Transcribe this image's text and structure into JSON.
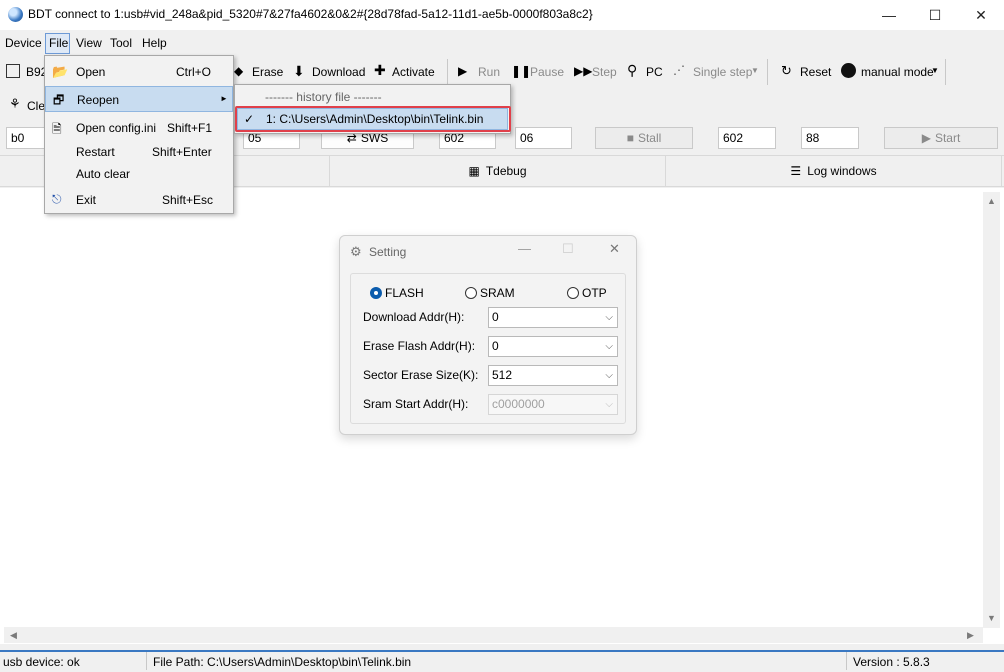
{
  "window": {
    "title": "BDT connect to 1:usb#vid_248a&pid_5320#7&27fa4602&0&2#{28d78fad-5a12-11d1-ae5b-0000f803a8c2}",
    "controls": {
      "minimize": "—",
      "maximize": "☐",
      "close": "✕"
    }
  },
  "menubar": {
    "device": "Device",
    "file": "File",
    "view": "View",
    "tool": "Tool",
    "help": "Help"
  },
  "toolbar1": {
    "chip_label": "B92",
    "erase": "Erase",
    "download": "Download",
    "activate": "Activate",
    "run": "Run",
    "pause": "Pause",
    "step": "Step",
    "pc": "PC",
    "single_step": "Single step",
    "reset": "Reset",
    "manual_mode": "manual mode"
  },
  "toolbar2": {
    "clear_label": "Cle"
  },
  "input_row": {
    "field1": "b0",
    "field2": "05",
    "sws": "SWS",
    "field3": "602",
    "field4": "06",
    "stall": "Stall",
    "field5": "602",
    "field6": "88",
    "start": "Start"
  },
  "tabs": {
    "tdebug": "Tdebug",
    "log_windows": "Log windows"
  },
  "file_menu": {
    "items": [
      {
        "label": "Open",
        "shortcut": "Ctrl+O"
      },
      {
        "label": "Reopen",
        "shortcut": ""
      },
      {
        "label": "Open config.ini",
        "shortcut": "Shift+F1"
      },
      {
        "label": "Restart",
        "shortcut": "Shift+Enter"
      },
      {
        "label": "Auto clear",
        "shortcut": ""
      },
      {
        "label": "Exit",
        "shortcut": "Shift+Esc"
      }
    ],
    "submenu_arrow": "►"
  },
  "reopen_submenu": {
    "header": "-------  history file  -------",
    "history_item": "1: C:\\Users\\Admin\\Desktop\\bin\\Telink.bin",
    "check": "✓"
  },
  "setting_dialog": {
    "title": "Setting",
    "radios": [
      {
        "label": "FLASH",
        "selected": true
      },
      {
        "label": "SRAM",
        "selected": false
      },
      {
        "label": "OTP",
        "selected": false
      }
    ],
    "fields": [
      {
        "label": "Download  Addr(H):",
        "value": "0",
        "enabled": true
      },
      {
        "label": "Erase Flash Addr(H):",
        "value": "0",
        "enabled": true
      },
      {
        "label": "Sector Erase Size(K):",
        "value": "512",
        "enabled": true
      },
      {
        "label": "Sram Start Addr(H):",
        "value": "c0000000",
        "enabled": false
      }
    ]
  },
  "status_bar": {
    "device_status": "usb device: ok",
    "file_path": "File Path:  C:\\Users\\Admin\\Desktop\\bin\\Telink.bin",
    "version": "Version : 5.8.3"
  },
  "colors": {
    "accent": "#3a78c2",
    "selection": "#c8dcf0",
    "highlight_outline": "#e0404a",
    "radio_selected": "#0b5cad"
  }
}
